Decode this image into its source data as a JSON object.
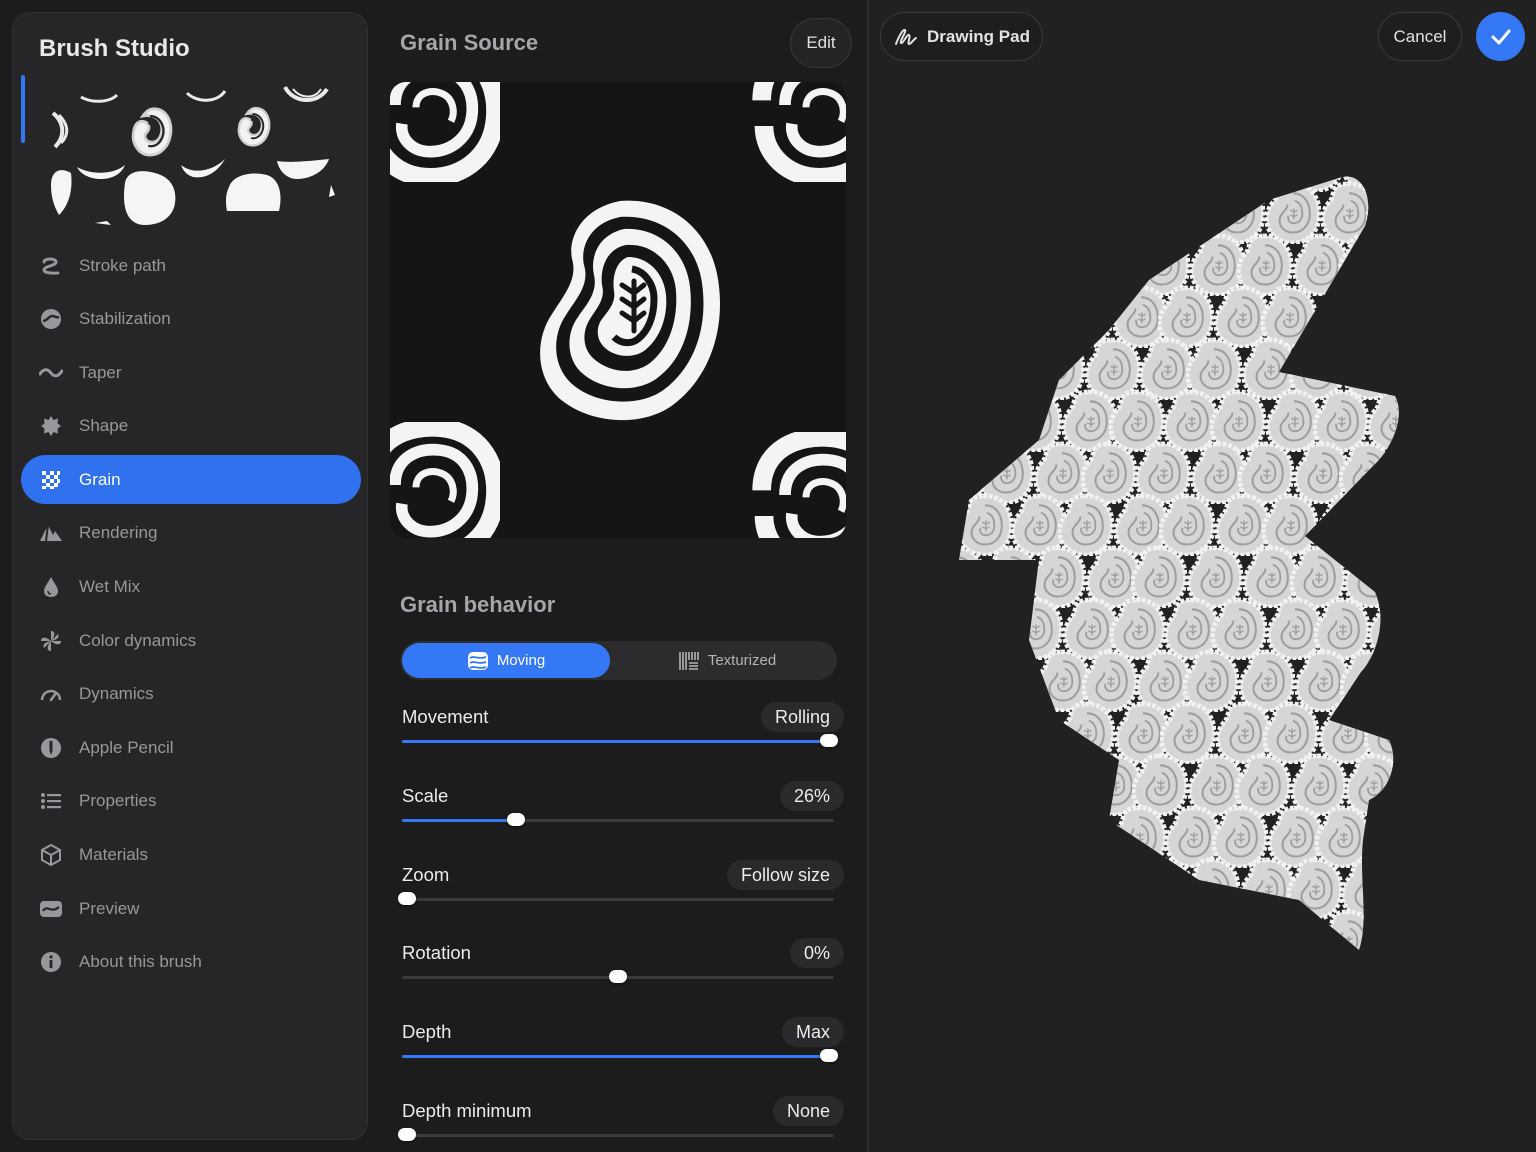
{
  "app": {
    "title": "Brush Studio"
  },
  "sidebar": {
    "items": [
      {
        "label": "Stroke path",
        "icon": "stroke-path-icon",
        "active": false
      },
      {
        "label": "Stabilization",
        "icon": "stabilization-icon",
        "active": false
      },
      {
        "label": "Taper",
        "icon": "taper-icon",
        "active": false
      },
      {
        "label": "Shape",
        "icon": "shape-icon",
        "active": false
      },
      {
        "label": "Grain",
        "icon": "grain-icon",
        "active": true
      },
      {
        "label": "Rendering",
        "icon": "rendering-icon",
        "active": false
      },
      {
        "label": "Wet Mix",
        "icon": "wet-mix-icon",
        "active": false
      },
      {
        "label": "Color dynamics",
        "icon": "color-dynamics-icon",
        "active": false
      },
      {
        "label": "Dynamics",
        "icon": "dynamics-icon",
        "active": false
      },
      {
        "label": "Apple Pencil",
        "icon": "apple-pencil-icon",
        "active": false
      },
      {
        "label": "Properties",
        "icon": "properties-icon",
        "active": false
      },
      {
        "label": "Materials",
        "icon": "materials-icon",
        "active": false
      },
      {
        "label": "Preview",
        "icon": "preview-icon",
        "active": false
      },
      {
        "label": "About this brush",
        "icon": "info-icon",
        "active": false
      }
    ]
  },
  "grain_source": {
    "title": "Grain Source",
    "edit_label": "Edit"
  },
  "grain_behavior": {
    "title": "Grain behavior",
    "modes": {
      "moving": "Moving",
      "texturized": "Texturized",
      "selected": "Moving"
    },
    "sliders": [
      {
        "label": "Movement",
        "value": "Rolling",
        "fraction": 0.99,
        "filled": true
      },
      {
        "label": "Scale",
        "value": "26%",
        "fraction": 0.265,
        "filled": true
      },
      {
        "label": "Zoom",
        "value": "Follow size",
        "fraction": 0.01,
        "filled": false
      },
      {
        "label": "Rotation",
        "value": "0%",
        "fraction": 0.5,
        "filled": false
      },
      {
        "label": "Depth",
        "value": "Max",
        "fraction": 0.99,
        "filled": true
      },
      {
        "label": "Depth minimum",
        "value": "None",
        "fraction": 0.01,
        "filled": false
      }
    ]
  },
  "drawing_pad": {
    "label": "Drawing Pad",
    "cancel_label": "Cancel",
    "done_icon": "checkmark-icon"
  },
  "colors": {
    "accent": "#3478f6",
    "active_menu": "#2f71ee",
    "panel": "#262628",
    "background": "#1c1c1d"
  }
}
